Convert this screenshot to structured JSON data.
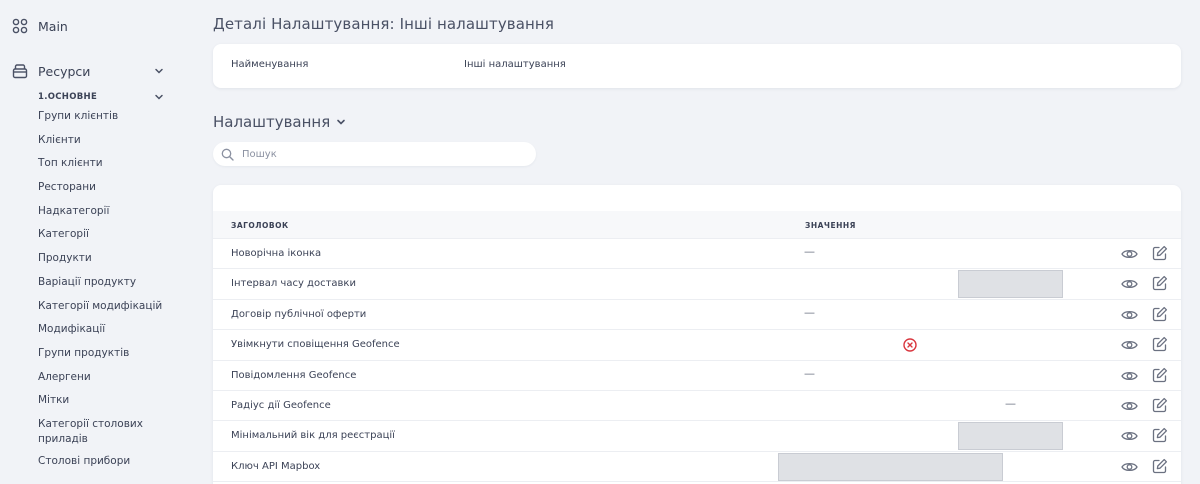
{
  "sidebar": {
    "main_label": "Main",
    "resources_label": "Ресурси",
    "section_label": "1.ОСНОВНЕ",
    "items": [
      "Групи клієнтів",
      "Клієнти",
      "Топ клієнти",
      "Ресторани",
      "Надкатегорії",
      "Категорії",
      "Продукти",
      "Варіації продукту",
      "Категорії модифікацій",
      "Модифікації",
      "Групи продуктів",
      "Алергени",
      "Мітки",
      "Категорії столових приладів",
      "Столові прибори"
    ]
  },
  "header": {
    "title": "Деталі Налаштування: Інші налаштування"
  },
  "details": {
    "name_key": "Найменування",
    "name_value": "Інші налаштування"
  },
  "settings": {
    "title": "Налаштування",
    "search_placeholder": "Пошук",
    "columns": {
      "title": "ЗАГОЛОВОК",
      "value": "ЗНАЧЕННЯ"
    },
    "rows": [
      {
        "name": "Новорічна іконка",
        "value": "—"
      },
      {
        "name": "Інтервал часу доставки",
        "value": ""
      },
      {
        "name": "Договір публічної оферти",
        "value": "—"
      },
      {
        "name": "Увімкнути сповіщення Geofence",
        "value": ""
      },
      {
        "name": "Повідомлення Geofence",
        "value": "—"
      },
      {
        "name": "Радіус дії Geofence",
        "value": "—"
      },
      {
        "name": "Мінімальний вік для реєстрації",
        "value": ""
      },
      {
        "name": "Ключ API Mapbox",
        "value": ""
      }
    ]
  },
  "icons": {
    "main": "grid-icon",
    "resources": "box-icon",
    "view": "eye-icon",
    "edit": "edit-icon",
    "disabled": "x-circle-icon"
  },
  "colors": {
    "disabled": "#d9363e",
    "icon": "#6b7181"
  }
}
